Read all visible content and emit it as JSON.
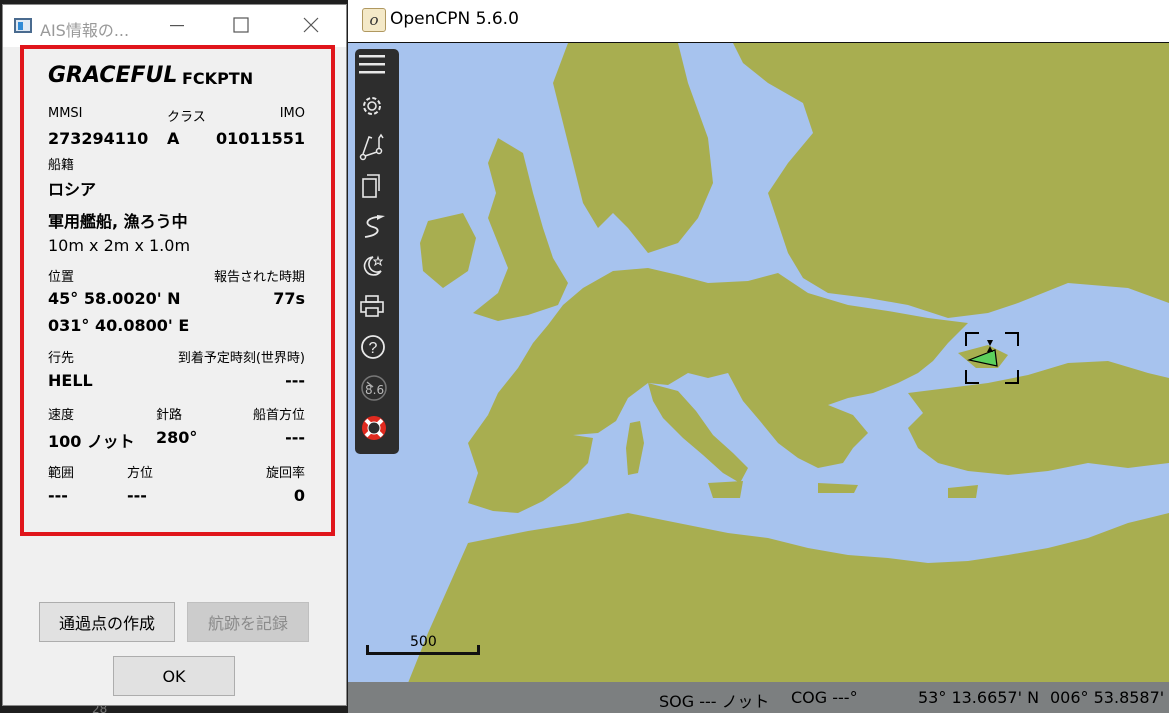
{
  "main_window": {
    "title": "OpenCPN 5.6.0",
    "app_icon_glyph": "o",
    "toolbar": [
      {
        "icon": "hamburger-menu-icon"
      },
      {
        "icon": "gear-icon"
      },
      {
        "icon": "route-icon"
      },
      {
        "icon": "documents-icon"
      },
      {
        "icon": "track-icon"
      },
      {
        "icon": "night-mode-icon"
      },
      {
        "icon": "printer-icon"
      },
      {
        "icon": "help-icon"
      },
      {
        "icon": "tide-gauge-icon",
        "label": "8.6"
      },
      {
        "icon": "lifebuoy-icon"
      }
    ],
    "scale_bar_label": "500",
    "status": {
      "sog": "SOG --- ノット",
      "cog": "COG ---°",
      "lat": "53° 13.6657' N",
      "lon": "006° 53.8587' E"
    },
    "colors": {
      "sea": "#a7c3ee",
      "land": "#a8ae50",
      "toolbar": "#2d2d2d"
    }
  },
  "behind_text": "28",
  "ais_dialog": {
    "title": "AIS情報の...",
    "ship_name": "GRACEFUL",
    "callsign": "FCKPTN",
    "mmsi_label": "MMSI",
    "mmsi": "273294110",
    "class_label": "クラス",
    "class": "A",
    "imo_label": "IMO",
    "imo": "01011551",
    "flag_label": "船籍",
    "flag": "ロシア",
    "vessel_type": "軍用艦船, 漁ろう中",
    "dimensions": "10m x 2m x 1.0m",
    "position_label": "位置",
    "reported_label": "報告された時期",
    "lat": "45° 58.0020' N",
    "reported": "77s",
    "lon": "031° 40.0800' E",
    "destination_label": "行先",
    "eta_label": "到着予定時刻(世界時)",
    "destination": "HELL",
    "eta": "---",
    "speed_label": "速度",
    "course_label": "針路",
    "heading_label": "船首方位",
    "speed": "100 ノット",
    "course": "280°",
    "heading": "---",
    "range_label": "範囲",
    "bearing_label": "方位",
    "rot_label": "旋回率",
    "range": "---",
    "bearing": "---",
    "rot": "0",
    "btn_waypoint": "通過点の作成",
    "btn_track": "航跡を記録",
    "btn_ok": "OK"
  }
}
